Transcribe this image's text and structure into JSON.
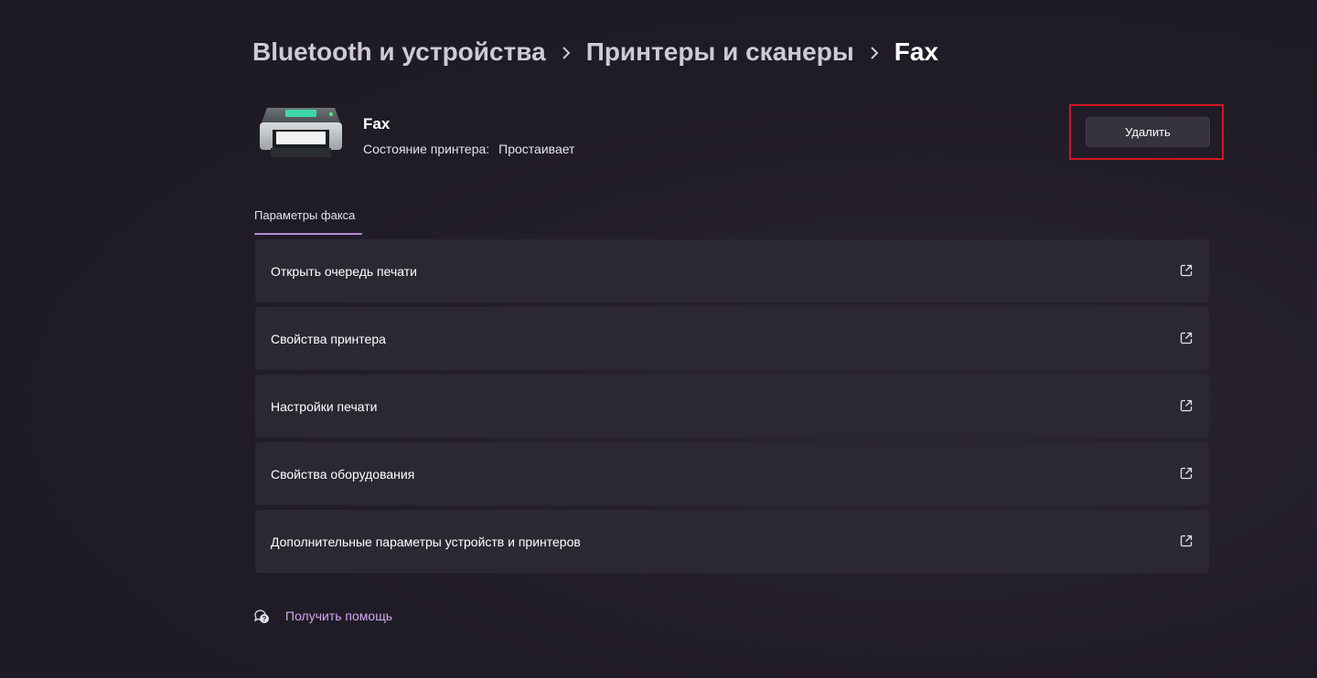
{
  "breadcrumb": {
    "items": [
      "Bluetooth и устройства",
      "Принтеры и сканеры"
    ],
    "current": "Fax"
  },
  "device": {
    "name": "Fax",
    "status_label": "Состояние принтера:",
    "status_value": "Простаивает",
    "icon": "printer-icon"
  },
  "actions": {
    "remove_label": "Удалить"
  },
  "section": {
    "title": "Параметры факса"
  },
  "settings": [
    {
      "label": "Открыть очередь печати",
      "icon": "open-external-icon"
    },
    {
      "label": "Свойства принтера",
      "icon": "open-external-icon"
    },
    {
      "label": "Настройки печати",
      "icon": "open-external-icon"
    },
    {
      "label": "Свойства оборудования",
      "icon": "open-external-icon"
    },
    {
      "label": "Дополнительные параметры устройств и принтеров",
      "icon": "open-external-icon"
    }
  ],
  "help": {
    "label": "Получить помощь",
    "icon": "help-icon"
  },
  "colors": {
    "background": "#201c27",
    "card": "#2c2833",
    "accent": "#d3a9ef",
    "highlight_border": "#d0161e"
  }
}
